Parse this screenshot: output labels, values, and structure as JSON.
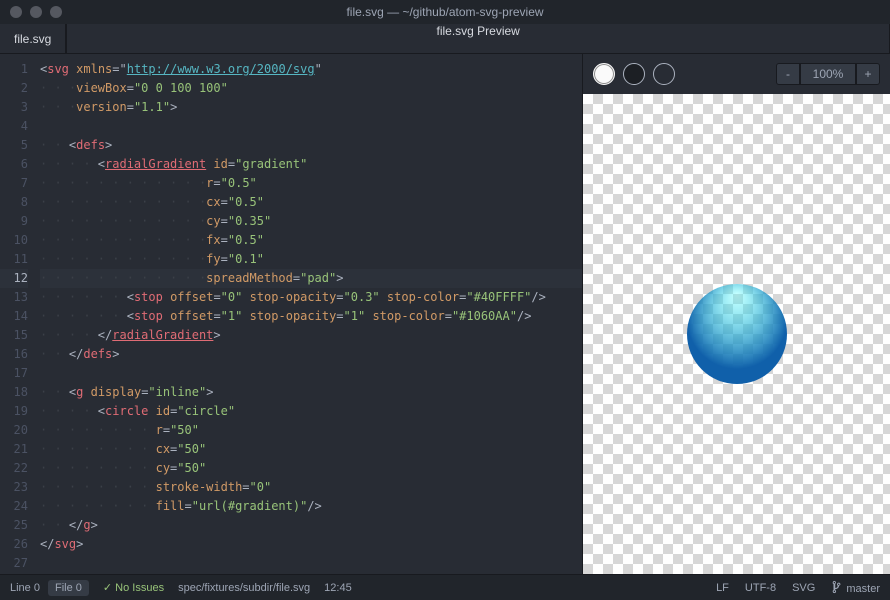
{
  "window_title": "file.svg — ~/github/atom-svg-preview",
  "tabs": {
    "editor": "file.svg",
    "preview": "file.svg Preview"
  },
  "highlighted_line": 12,
  "code": [
    {
      "n": 1,
      "indent": 0,
      "tokens": [
        [
          "pun",
          "<"
        ],
        [
          "tag",
          "svg"
        ],
        [
          "pun",
          " "
        ],
        [
          "attr",
          "xmlns"
        ],
        [
          "pun",
          "="
        ],
        [
          "pun",
          "\""
        ],
        [
          "link",
          "http://www.w3.org/2000/svg"
        ],
        [
          "pun",
          "\""
        ]
      ]
    },
    {
      "n": 2,
      "indent": 5,
      "tokens": [
        [
          "attr",
          "viewBox"
        ],
        [
          "pun",
          "="
        ],
        [
          "str",
          "\"0 0 100 100\""
        ]
      ]
    },
    {
      "n": 3,
      "indent": 5,
      "tokens": [
        [
          "attr",
          "version"
        ],
        [
          "pun",
          "="
        ],
        [
          "str",
          "\"1.1\""
        ],
        [
          "pun",
          ">"
        ]
      ]
    },
    {
      "n": 4,
      "indent": 0,
      "tokens": []
    },
    {
      "n": 5,
      "indent": 4,
      "tokens": [
        [
          "pun",
          "<"
        ],
        [
          "tag",
          "defs"
        ],
        [
          "pun",
          ">"
        ]
      ]
    },
    {
      "n": 6,
      "indent": 8,
      "tokens": [
        [
          "pun",
          "<"
        ],
        [
          "tag ul",
          "radialGradient"
        ],
        [
          "pun",
          " "
        ],
        [
          "attr",
          "id"
        ],
        [
          "pun",
          "="
        ],
        [
          "str",
          "\"gradient\""
        ]
      ]
    },
    {
      "n": 7,
      "indent": 23,
      "tokens": [
        [
          "attr",
          "r"
        ],
        [
          "pun",
          "="
        ],
        [
          "str",
          "\"0.5\""
        ]
      ]
    },
    {
      "n": 8,
      "indent": 23,
      "tokens": [
        [
          "attr",
          "cx"
        ],
        [
          "pun",
          "="
        ],
        [
          "str",
          "\"0.5\""
        ]
      ]
    },
    {
      "n": 9,
      "indent": 23,
      "tokens": [
        [
          "attr",
          "cy"
        ],
        [
          "pun",
          "="
        ],
        [
          "str",
          "\"0.35\""
        ]
      ]
    },
    {
      "n": 10,
      "indent": 23,
      "tokens": [
        [
          "attr",
          "fx"
        ],
        [
          "pun",
          "="
        ],
        [
          "str",
          "\"0.5\""
        ]
      ]
    },
    {
      "n": 11,
      "indent": 23,
      "tokens": [
        [
          "attr",
          "fy"
        ],
        [
          "pun",
          "="
        ],
        [
          "str",
          "\"0.1\""
        ]
      ]
    },
    {
      "n": 12,
      "indent": 23,
      "tokens": [
        [
          "attr",
          "spreadMethod"
        ],
        [
          "pun",
          "="
        ],
        [
          "str",
          "\"pad\""
        ],
        [
          "pun",
          ">"
        ]
      ]
    },
    {
      "n": 13,
      "indent": 12,
      "tokens": [
        [
          "pun",
          "<"
        ],
        [
          "tag",
          "stop"
        ],
        [
          "pun",
          " "
        ],
        [
          "attr",
          "offset"
        ],
        [
          "pun",
          "="
        ],
        [
          "str",
          "\"0\""
        ],
        [
          "pun",
          " "
        ],
        [
          "attr",
          "stop-opacity"
        ],
        [
          "pun",
          "="
        ],
        [
          "str",
          "\"0.3\""
        ],
        [
          "pun",
          " "
        ],
        [
          "attr",
          "stop-color"
        ],
        [
          "pun",
          "="
        ],
        [
          "str",
          "\"#40FFFF\""
        ],
        [
          "pun",
          "/>"
        ]
      ]
    },
    {
      "n": 14,
      "indent": 12,
      "tokens": [
        [
          "pun",
          "<"
        ],
        [
          "tag",
          "stop"
        ],
        [
          "pun",
          " "
        ],
        [
          "attr",
          "offset"
        ],
        [
          "pun",
          "="
        ],
        [
          "str",
          "\"1\""
        ],
        [
          "pun",
          " "
        ],
        [
          "attr",
          "stop-opacity"
        ],
        [
          "pun",
          "="
        ],
        [
          "str",
          "\"1\""
        ],
        [
          "pun",
          " "
        ],
        [
          "attr",
          "stop-color"
        ],
        [
          "pun",
          "="
        ],
        [
          "str",
          "\"#1060AA\""
        ],
        [
          "pun",
          "/>"
        ]
      ]
    },
    {
      "n": 15,
      "indent": 8,
      "tokens": [
        [
          "pun",
          "</"
        ],
        [
          "tag ul",
          "radialGradient"
        ],
        [
          "pun",
          ">"
        ]
      ]
    },
    {
      "n": 16,
      "indent": 4,
      "tokens": [
        [
          "pun",
          "</"
        ],
        [
          "tag",
          "defs"
        ],
        [
          "pun",
          ">"
        ]
      ]
    },
    {
      "n": 17,
      "indent": 0,
      "tokens": []
    },
    {
      "n": 18,
      "indent": 4,
      "tokens": [
        [
          "pun",
          "<"
        ],
        [
          "tag",
          "g"
        ],
        [
          "pun",
          " "
        ],
        [
          "attr",
          "display"
        ],
        [
          "pun",
          "="
        ],
        [
          "str",
          "\"inline\""
        ],
        [
          "pun",
          ">"
        ]
      ]
    },
    {
      "n": 19,
      "indent": 8,
      "tokens": [
        [
          "pun",
          "<"
        ],
        [
          "tag",
          "circle"
        ],
        [
          "pun",
          " "
        ],
        [
          "attr",
          "id"
        ],
        [
          "pun",
          "="
        ],
        [
          "str",
          "\"circle\""
        ]
      ]
    },
    {
      "n": 20,
      "indent": 16,
      "tokens": [
        [
          "attr",
          "r"
        ],
        [
          "pun",
          "="
        ],
        [
          "str",
          "\"50\""
        ]
      ]
    },
    {
      "n": 21,
      "indent": 16,
      "tokens": [
        [
          "attr",
          "cx"
        ],
        [
          "pun",
          "="
        ],
        [
          "str",
          "\"50\""
        ]
      ]
    },
    {
      "n": 22,
      "indent": 16,
      "tokens": [
        [
          "attr",
          "cy"
        ],
        [
          "pun",
          "="
        ],
        [
          "str",
          "\"50\""
        ]
      ]
    },
    {
      "n": 23,
      "indent": 16,
      "tokens": [
        [
          "attr",
          "stroke-width"
        ],
        [
          "pun",
          "="
        ],
        [
          "str",
          "\"0\""
        ]
      ]
    },
    {
      "n": 24,
      "indent": 16,
      "tokens": [
        [
          "attr",
          "fill"
        ],
        [
          "pun",
          "="
        ],
        [
          "str",
          "\"url(#gradient)\""
        ],
        [
          "pun",
          "/>"
        ]
      ]
    },
    {
      "n": 25,
      "indent": 4,
      "tokens": [
        [
          "pun",
          "</"
        ],
        [
          "tag",
          "g"
        ],
        [
          "pun",
          ">"
        ]
      ]
    },
    {
      "n": 26,
      "indent": 0,
      "tokens": [
        [
          "pun",
          "</"
        ],
        [
          "tag",
          "svg"
        ],
        [
          "pun",
          ">"
        ]
      ]
    },
    {
      "n": 27,
      "indent": 0,
      "tokens": []
    }
  ],
  "preview_toolbar": {
    "zoom_out": "-",
    "zoom_value": "100%",
    "zoom_in": "+"
  },
  "status": {
    "line": "Line  0",
    "file": "File   0",
    "issues": "No Issues",
    "path": "spec/fixtures/subdir/file.svg",
    "time": "12:45",
    "line_ending": "LF",
    "encoding": "UTF-8",
    "grammar": "SVG",
    "branch": "master"
  }
}
